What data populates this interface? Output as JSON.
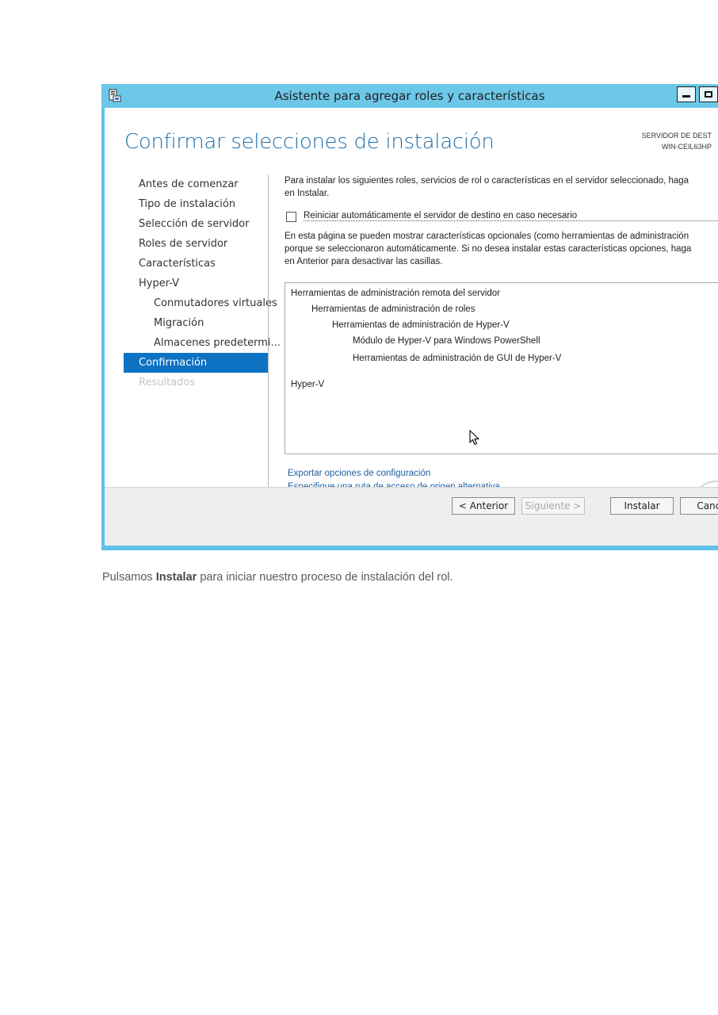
{
  "window": {
    "title": "Asistente para agregar roles y características"
  },
  "page": {
    "title": "Confirmar selecciones de instalación",
    "server_label_line1": "SERVIDOR DE DEST",
    "server_label_line2": "WIN-CEIL63HP"
  },
  "nav": {
    "items": [
      {
        "label": "Antes de comenzar"
      },
      {
        "label": "Tipo de instalación"
      },
      {
        "label": "Selección de servidor"
      },
      {
        "label": "Roles de servidor"
      },
      {
        "label": "Características"
      },
      {
        "label": "Hyper-V"
      },
      {
        "label": "Conmutadores virtuales"
      },
      {
        "label": "Migración"
      },
      {
        "label": "Almacenes predetermi..."
      },
      {
        "label": "Confirmación"
      },
      {
        "label": "Resultados"
      }
    ],
    "active": "Confirmación"
  },
  "content": {
    "intro_line1": "Para instalar los siguientes roles, servicios de rol o características en el servidor seleccionado, haga",
    "intro_line2": "en Instalar.",
    "restart_checkbox_label": "Reiniciar automáticamente el servidor de destino en caso necesario",
    "restart_checkbox_checked": false,
    "optional_line1": "En esta página se pueden mostrar características opcionales (como herramientas de administración",
    "optional_line2": "porque se seleccionaron automáticamente. Si no desea instalar estas características opciones, haga",
    "optional_line3": "en Anterior para desactivar las casillas.",
    "selections": [
      {
        "label": "Herramientas de administración remota del servidor"
      },
      {
        "label": "Herramientas de administración de roles"
      },
      {
        "label": "Herramientas de administración de Hyper-V"
      },
      {
        "label": "Módulo de Hyper-V para Windows PowerShell"
      },
      {
        "label": "Herramientas de administración de GUI de Hyper-V"
      },
      {
        "label": "Hyper-V"
      }
    ],
    "link_export": "Exportar opciones de configuración",
    "link_alt_source": "Especifique una ruta de acceso de origen alternativa"
  },
  "footer": {
    "back": "< Anterior",
    "next": "Siguiente >",
    "install": "Instalar",
    "cancel": "Cance"
  },
  "caption": {
    "prefix": "Pulsamos ",
    "bold": "Instalar",
    "suffix": " para iniciar nuestro proceso de instalación del rol."
  },
  "colors": {
    "titlebar": "#6cc7e8",
    "accent": "#0e72c2",
    "heading": "#1f6fa8",
    "link": "#1c5fa0"
  },
  "icons": [
    "server-manager-icon",
    "minimize-icon",
    "maximize-icon",
    "mouse-cursor-icon",
    "help-icon"
  ]
}
